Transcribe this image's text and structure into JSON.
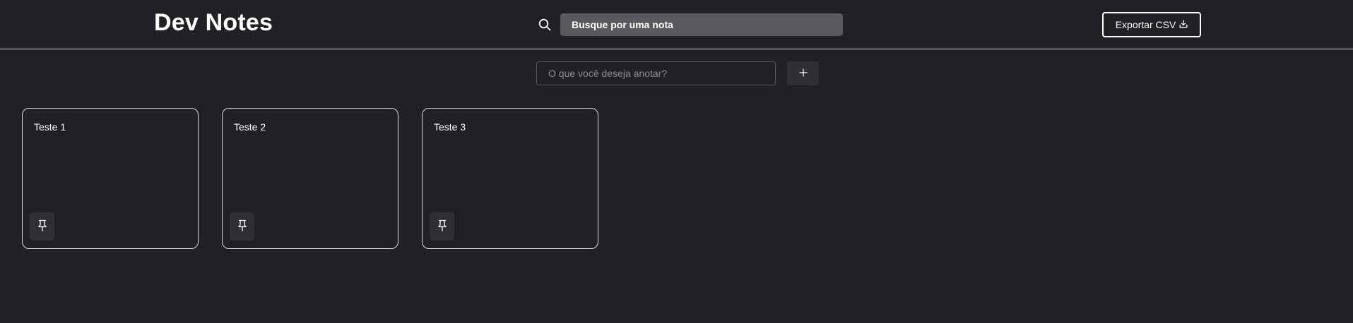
{
  "header": {
    "logo": "Dev Notes",
    "search_placeholder": "Busque por uma nota",
    "export_label": "Exportar CSV",
    "search_icon": "search-icon",
    "export_icon": "download-icon"
  },
  "add_note": {
    "placeholder": "O que você deseja anotar?",
    "add_label": "+"
  },
  "notes": [
    {
      "content": "Teste 1",
      "pin_icon": "pin-icon"
    },
    {
      "content": "Teste 2",
      "pin_icon": "pin-icon"
    },
    {
      "content": "Teste 3",
      "pin_icon": "pin-icon"
    }
  ],
  "colors": {
    "background": "#202125",
    "search_bg": "#58595d",
    "button_bg": "#2f3034",
    "border": "#d8d8d8",
    "text": "#ffffff"
  }
}
